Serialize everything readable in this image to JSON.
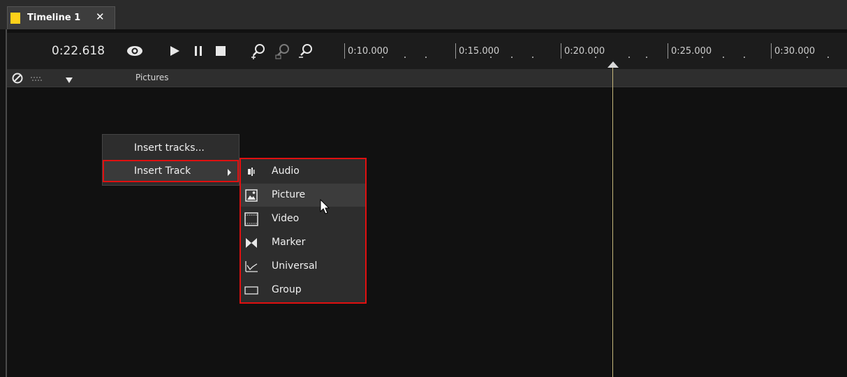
{
  "tab": {
    "title": "Timeline 1",
    "close": "✕",
    "swatch_color": "#ffd11a"
  },
  "toolbar": {
    "time": "0:22.618",
    "icons": [
      "eye-icon",
      "play-icon",
      "pause-icon",
      "stop-icon",
      "zoom-in-icon",
      "zoom-fit-icon",
      "zoom-out-icon"
    ]
  },
  "ruler": {
    "labels": [
      "0:10.000",
      "0:15.000",
      "0:20.000",
      "0:25.000",
      "0:30.000"
    ]
  },
  "track": {
    "name": "Pictures"
  },
  "context_menu": {
    "items": [
      "Insert tracks...",
      "Insert Track"
    ]
  },
  "submenu": {
    "items": [
      "Audio",
      "Picture",
      "Video",
      "Marker",
      "Universal",
      "Group"
    ],
    "highlight_color": "#e01010"
  },
  "colors": {
    "playhead": "#c7b87c",
    "background": "#141414"
  }
}
